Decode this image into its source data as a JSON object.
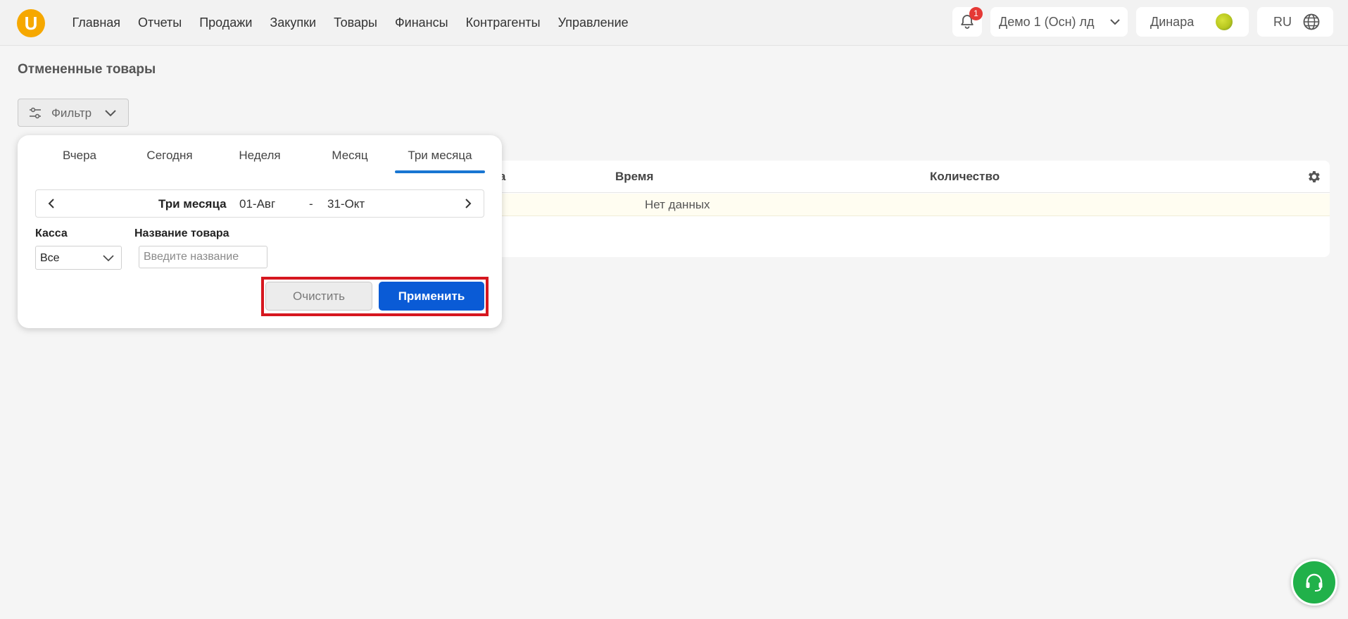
{
  "app": {
    "logo_letter": "U",
    "brand_color": "#f6a800",
    "logo_icon": "app-logo-icon"
  },
  "nav": {
    "items": [
      "Главная",
      "Отчеты",
      "Продажи",
      "Закупки",
      "Товары",
      "Финансы",
      "Контрагенты",
      "Управление"
    ]
  },
  "header": {
    "notification_count": "1",
    "org_selector": "Демо 1 (Осн) лд",
    "user_name": "Динара",
    "language": "RU"
  },
  "page": {
    "title": "Отмененные товары",
    "filter_label": "Фильтр"
  },
  "table": {
    "columns": [
      "ара",
      "Время",
      "Количество"
    ],
    "empty_text": "Нет данных"
  },
  "filter_panel": {
    "tabs": [
      "Вчера",
      "Сегодня",
      "Неделя",
      "Месяц",
      "Три месяца"
    ],
    "active_tab": "Три месяца",
    "range_label": "Три месяца",
    "date_from": "01-Авг",
    "date_separator": "-",
    "date_to": "31-Окт",
    "cash_label": "Касса",
    "cash_value": "Все",
    "product_label": "Название товара",
    "product_placeholder": "Введите название",
    "clear_label": "Очистить",
    "apply_label": "Применить"
  },
  "colors": {
    "accent_blue": "#0a5bd6",
    "tab_underline": "#1976d2",
    "highlight_red": "#d6171f",
    "badge_red": "#e53935",
    "support_green": "#21b14a"
  }
}
